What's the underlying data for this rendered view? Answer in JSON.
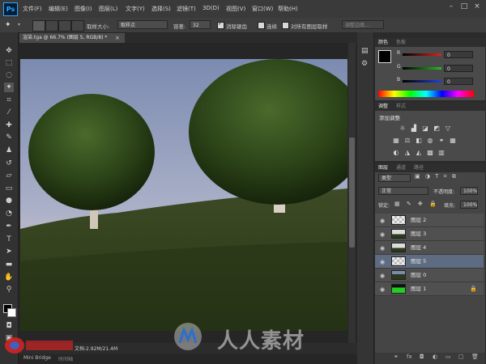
{
  "app": {
    "logo": "Ps"
  },
  "menu": [
    "文件(F)",
    "编辑(E)",
    "图像(I)",
    "图层(L)",
    "文字(Y)",
    "选择(S)",
    "滤镜(T)",
    "3D(D)",
    "视图(V)",
    "窗口(W)",
    "帮助(H)"
  ],
  "options": {
    "sample_size_label": "取样大小:",
    "sample_size_value": "取样点",
    "tolerance_label": "容差:",
    "tolerance_value": "32",
    "antialias_label": "消除锯齿",
    "contiguous_label": "连续",
    "all_layers_label": "对所有图层取样",
    "refine_edge_label": "调整边缘..."
  },
  "document": {
    "tab_title": "渲染.tga @ 66.7% (图层 5, RGB/8) *",
    "close_glyph": "×",
    "status": "文档:2.92M/21.4M",
    "mini_bridge_tab": "Mini Bridge",
    "timeline_tab": "时间轴"
  },
  "color_panel": {
    "tabs": [
      "颜色",
      "色板"
    ],
    "channels": [
      {
        "label": "R",
        "value": "0",
        "color": "#e02020"
      },
      {
        "label": "G",
        "value": "0",
        "color": "#20c020"
      },
      {
        "label": "B",
        "value": "0",
        "color": "#2040e0"
      }
    ]
  },
  "adjustments_panel": {
    "tabs": [
      "调整",
      "样式"
    ],
    "title": "添加调整",
    "row1_icons": [
      "brightness-icon",
      "levels-icon",
      "curves-icon",
      "exposure-icon",
      "vibrance-icon"
    ],
    "row2_icons": [
      "hue-icon",
      "color-balance-icon",
      "bw-icon",
      "photo-filter-icon",
      "channel-mixer-icon",
      "color-lookup-icon"
    ],
    "row3_icons": [
      "invert-icon",
      "posterize-icon",
      "threshold-icon",
      "selective-color-icon",
      "gradient-map-icon"
    ]
  },
  "layers_panel": {
    "tabs": [
      "图层",
      "通道",
      "路径"
    ],
    "filter_label": "类型",
    "blend_mode": "正常",
    "opacity_label": "不透明度:",
    "opacity_value": "100%",
    "lock_label": "锁定:",
    "fill_label": "填充:",
    "fill_value": "100%",
    "layers": [
      {
        "name": "图层 2",
        "selected": false,
        "thumb": "checker"
      },
      {
        "name": "图层 3",
        "selected": false,
        "thumb": "trees"
      },
      {
        "name": "图层 4",
        "selected": false,
        "thumb": "trees"
      },
      {
        "name": "图层 5",
        "selected": true,
        "thumb": "checker"
      },
      {
        "name": "图层 0",
        "selected": false,
        "thumb": "scene"
      },
      {
        "name": "图层 1",
        "selected": false,
        "thumb": "green",
        "locked": true
      }
    ]
  },
  "watermark": {
    "text": "人人素材"
  },
  "colors": {
    "accent": "#31a8ff",
    "selection": "#5e6c82"
  }
}
